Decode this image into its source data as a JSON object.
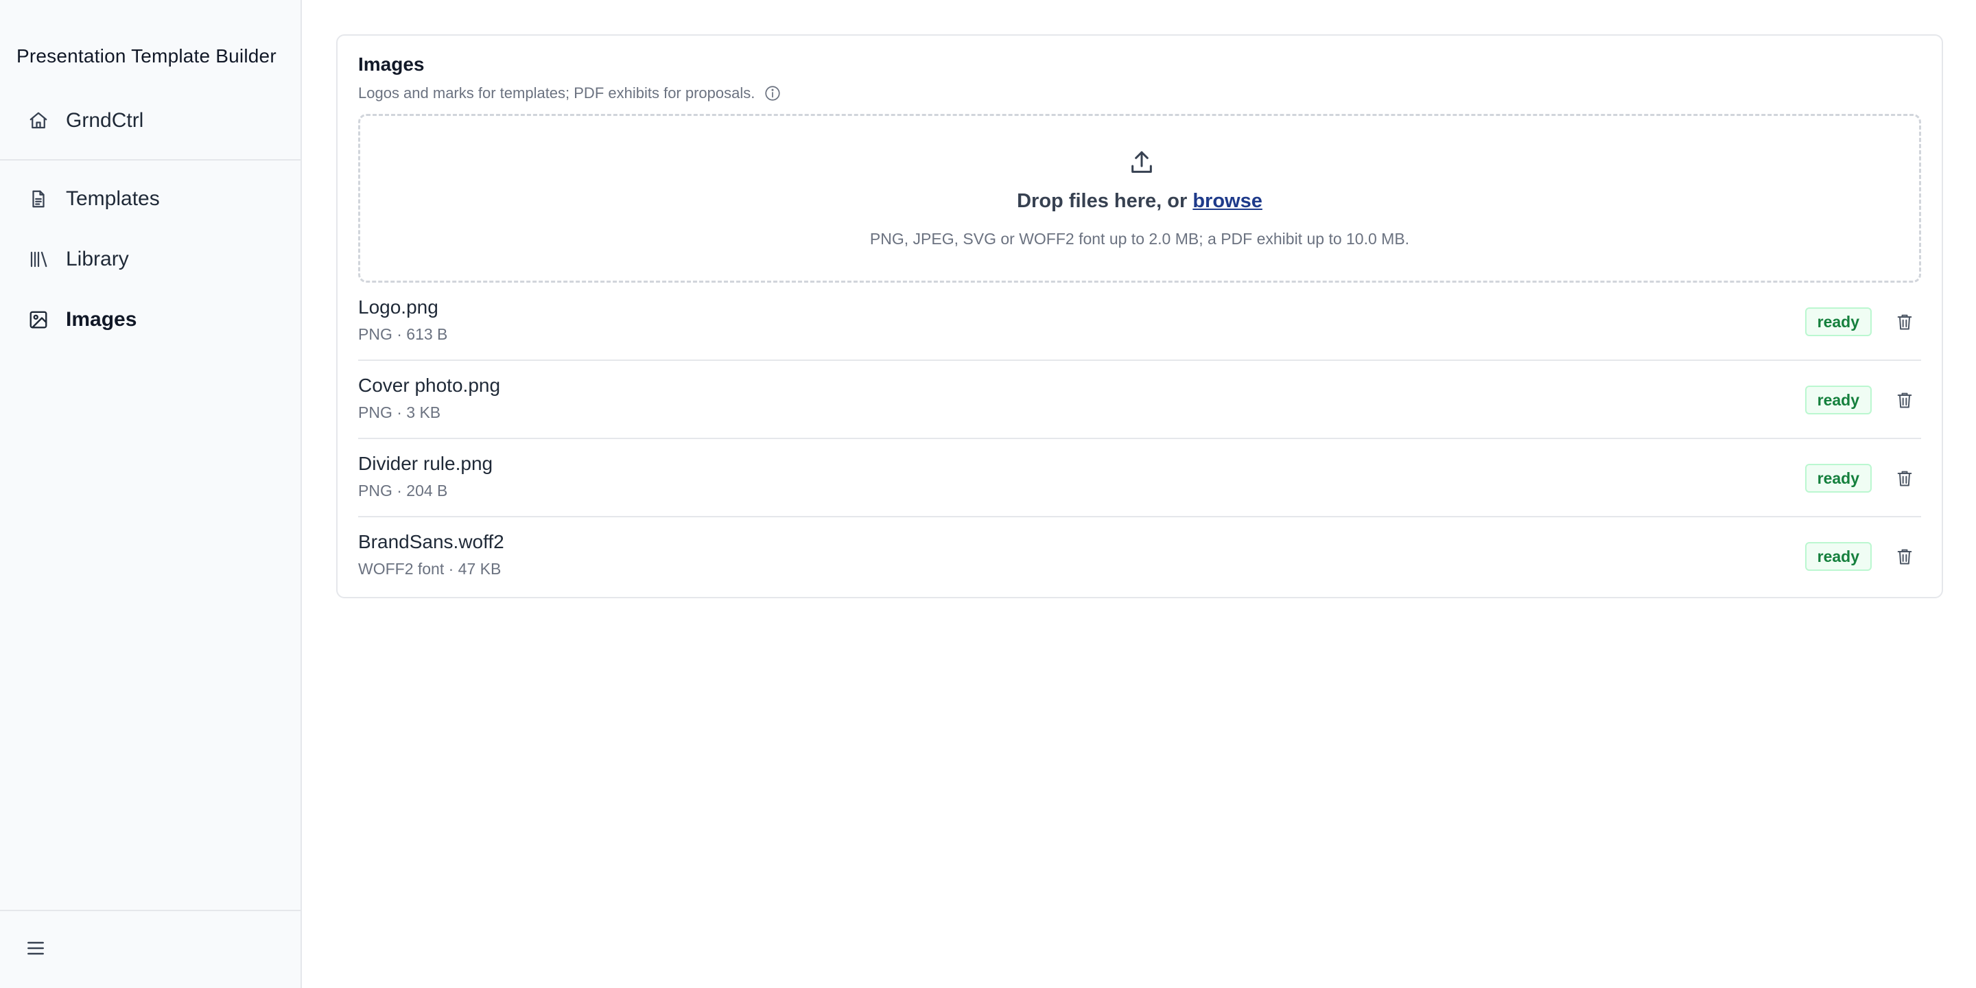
{
  "app": {
    "title": "Presentation Template Builder"
  },
  "sidebar": {
    "workspace": {
      "label": "GrndCtrl",
      "icon": "home-icon"
    },
    "items": [
      {
        "label": "Templates",
        "icon": "document-icon",
        "active": false
      },
      {
        "label": "Library",
        "icon": "library-icon",
        "active": false
      },
      {
        "label": "Images",
        "icon": "image-icon",
        "active": true
      }
    ],
    "menu_icon": "hamburger-menu-icon"
  },
  "card": {
    "title": "Images",
    "subtitle": "Logos and marks for templates; PDF exhibits for proposals.",
    "info_icon": "info-icon"
  },
  "dropzone": {
    "icon": "upload-icon",
    "prompt": "Drop files here, or ",
    "browse_label": "browse",
    "hint": "PNG, JPEG, SVG or WOFF2 font up to 2.0 MB; a PDF exhibit up to 10.0 MB."
  },
  "files": [
    {
      "name": "Logo.png",
      "meta": "PNG · 613 B",
      "status": "ready"
    },
    {
      "name": "Cover photo.png",
      "meta": "PNG · 3 KB",
      "status": "ready"
    },
    {
      "name": "Divider rule.png",
      "meta": "PNG · 204 B",
      "status": "ready"
    },
    {
      "name": "BrandSans.woff2",
      "meta": "WOFF2 font · 47 KB",
      "status": "ready"
    }
  ],
  "colors": {
    "sidebar_bg": "#f8fafc",
    "badge_bg": "#f0fdf4",
    "badge_text": "#15803d",
    "link": "#1e3a8a"
  }
}
